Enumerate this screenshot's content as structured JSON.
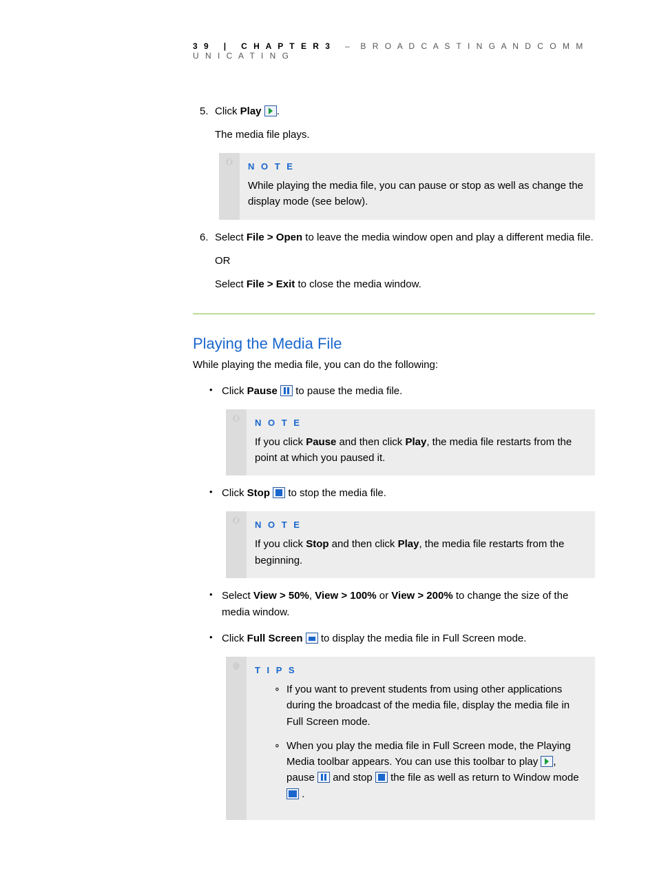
{
  "header": {
    "page_number": "3 9",
    "separator": "|",
    "chapter_label": "C H A P T E R 3",
    "dash": "–",
    "chapter_title": "B R O A D C A S T I N G  A N D  C O M M U N I C A T I N G"
  },
  "steps": [
    {
      "num": "5.",
      "prefix": "Click ",
      "bold": "Play",
      "icon": "play",
      "trailing": ".",
      "line2": "The media file plays.",
      "note": {
        "label": "N O T E",
        "text": "While playing the media file, you can pause or stop as well as change the display mode (see below)."
      }
    },
    {
      "num": "6.",
      "prefix": "Select ",
      "bold": "File > Open",
      "suffix": " to leave the media window open and play a different media file.",
      "line2": "OR",
      "line3_prefix": "Select ",
      "line3_bold": "File > Exit",
      "line3_suffix": " to close the media window."
    }
  ],
  "section": {
    "title": "Playing the Media File",
    "intro": "While playing the media file, you can do the following:"
  },
  "bullets": {
    "b1": {
      "prefix": "Click ",
      "bold": "Pause",
      "icon": "pause",
      "suffix": " to pause the media file.",
      "note": {
        "label": "N O T E",
        "pre": "If you click ",
        "bold1": "Pause",
        "mid": " and then click ",
        "bold2": "Play",
        "post": ", the media file restarts from the point at which you paused it."
      }
    },
    "b2": {
      "prefix": "Click ",
      "bold": "Stop",
      "icon": "stop",
      "suffix": " to stop the media file.",
      "note": {
        "label": "N O T E",
        "pre": "If you click ",
        "bold1": "Stop",
        "mid": " and then click ",
        "bold2": "Play",
        "post": ", the media file restarts from the beginning."
      }
    },
    "b3": {
      "prefix": "Select ",
      "bold1": "View > 50%",
      "sep1": ", ",
      "bold2": "View > 100%",
      "sep2": " or ",
      "bold3": "View > 200%",
      "suffix": " to change the size of the media window."
    },
    "b4": {
      "prefix": "Click ",
      "bold": "Full Screen",
      "icon": "fullscreen",
      "suffix": " to display the media file in Full Screen mode.",
      "tips": {
        "label": "T I P S",
        "t1": "If you want to prevent students from using other applications during the broadcast of the media file, display the media file in Full Screen mode.",
        "t2": {
          "pre": "When you play the media file in Full Screen mode, the Playing Media toolbar appears. You can use this toolbar to play ",
          "mid1": ", pause ",
          "mid2": " and stop ",
          "mid3": " the file as well as return to Window mode ",
          "post": " ."
        }
      }
    }
  }
}
